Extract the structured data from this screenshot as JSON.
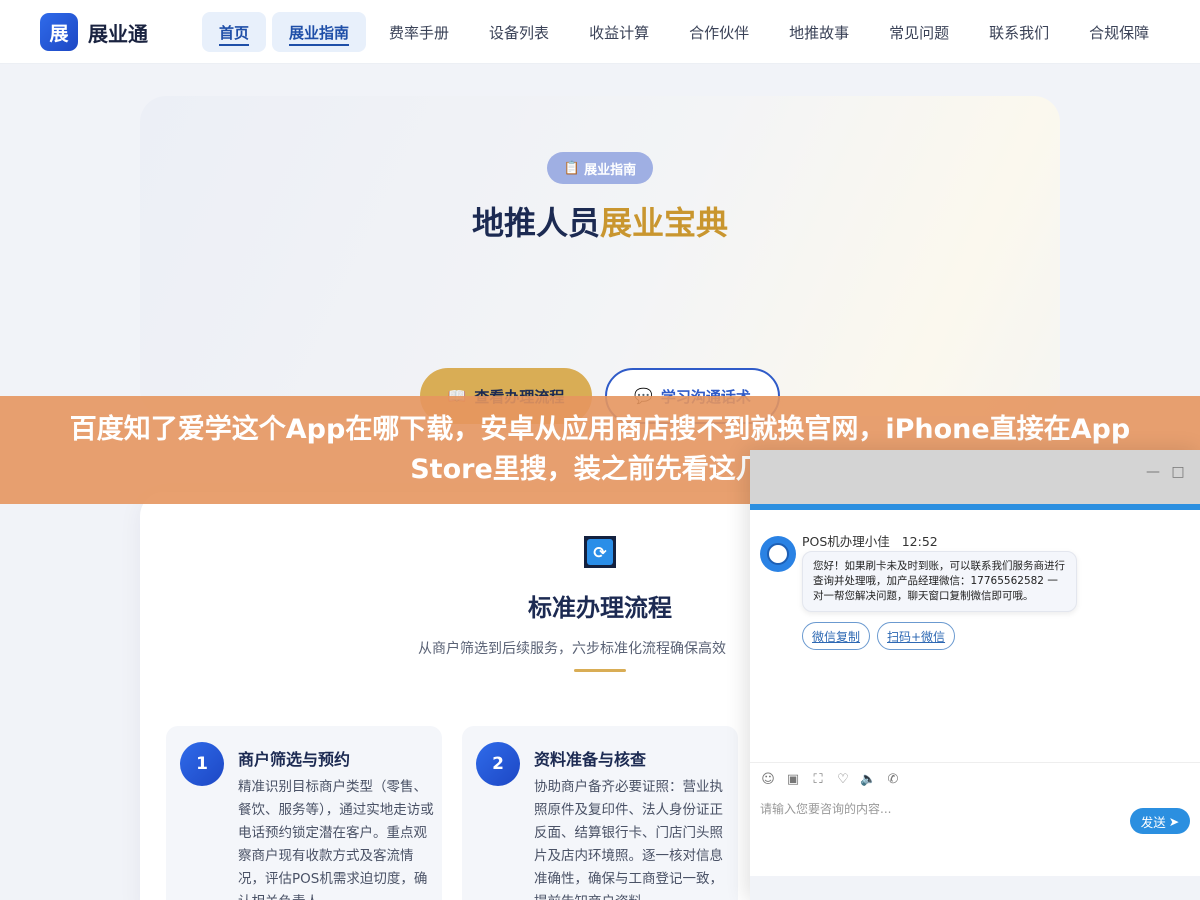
{
  "brand": {
    "logo_char": "展",
    "name": "展业通"
  },
  "nav": {
    "items": [
      {
        "label": "首页",
        "active": true
      },
      {
        "label": "展业指南",
        "active": true
      },
      {
        "label": "费率手册"
      },
      {
        "label": "设备列表"
      },
      {
        "label": "收益计算"
      },
      {
        "label": "合作伙伴"
      },
      {
        "label": "地推故事"
      },
      {
        "label": "常见问题"
      },
      {
        "label": "联系我们"
      },
      {
        "label": "合规保障"
      }
    ]
  },
  "hero": {
    "badge_icon": "📋",
    "badge": "展业指南",
    "title_main": "地推人员",
    "title_accent": "展业宝典",
    "btn_flow_icon": "📖",
    "btn_flow": "查看办理流程",
    "btn_talk_icon": "💬",
    "btn_talk": "学习沟通话术"
  },
  "banner": {
    "text": "百度知了爱学这个App在哪下载，安卓从应用商店搜不到就换官网，iPhone直接在App Store里搜，装之前先看这几点"
  },
  "section": {
    "icon": "⟳",
    "title": "标准办理流程",
    "subtitle": "从商户筛选到后续服务，六步标准化流程确保高效"
  },
  "steps": [
    {
      "num": "1",
      "title": "商户筛选与预约",
      "desc": "精准识别目标商户类型（零售、餐饮、服务等），通过实地走访或电话预约锁定潜在客户。重点观察商户现有收款方式及客流情况，评估POS机需求迫切度，确认相关负责人"
    },
    {
      "num": "2",
      "title": "资料准备与核查",
      "desc": "协助商户备齐必要证照：营业执照原件及复印件、法人身份证正反面、结算银行卡、门店门头照片及店内环境照。逐一核对信息准确性，确保与工商登记一致，提前告知商户资料"
    }
  ],
  "chat": {
    "minimize": "—",
    "maximize": "□",
    "sender": "POS机办理小佳",
    "time": "12:52",
    "message": "您好！如果刷卡未及时到账，可以联系我们服务商进行查询并处理哦，加产品经理微信：17765562582 一对一帮您解决问题，聊天窗口复制微信即可哦。",
    "actions": [
      "微信复制",
      "扫码+微信"
    ],
    "tools": [
      "☺",
      "▣",
      "⛶",
      "♡",
      "🔈",
      "✆"
    ],
    "placeholder": "请输入您要咨询的内容...",
    "send": "发送",
    "send_icon": "➤"
  }
}
